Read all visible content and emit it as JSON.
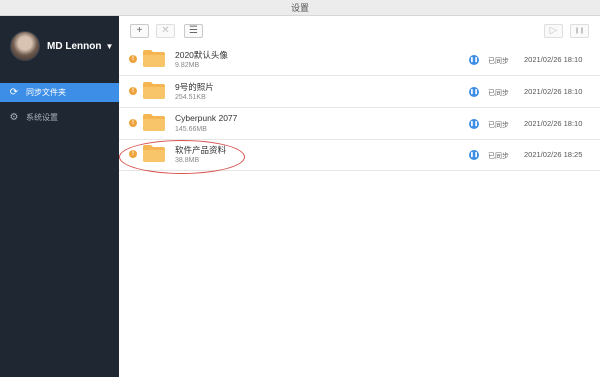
{
  "window": {
    "title": "设置"
  },
  "user": {
    "name": "MD Lennon",
    "caret": "▼"
  },
  "sidebar": {
    "items": [
      {
        "label": "同步文件夹",
        "icon": "sync-icon",
        "active": true
      },
      {
        "label": "系统设置",
        "icon": "gear-icon",
        "active": false
      }
    ]
  },
  "toolbar": {
    "add": "+",
    "remove": "✕",
    "list": "☰",
    "play": "▷",
    "pause": "❚❚"
  },
  "folders": [
    {
      "name": "2020默认头像",
      "size": "9.82MB",
      "status": "已同步",
      "time": "2021/02/26 18:10"
    },
    {
      "name": "9号的照片",
      "size": "254.51KB",
      "status": "已同步",
      "time": "2021/02/26 18:10"
    },
    {
      "name": "Cyberpunk 2077",
      "size": "145.66MB",
      "status": "已同步",
      "time": "2021/02/26 18:10"
    },
    {
      "name": "软件产品资料",
      "size": "38.8MB",
      "status": "已同步",
      "time": "2021/02/26 18:25"
    }
  ],
  "colors": {
    "sidebar": "#1f2732",
    "accent": "#3d8ee6",
    "folder": "#f5b552",
    "warning": "#f0a33d",
    "annotation": "#d9534f"
  }
}
